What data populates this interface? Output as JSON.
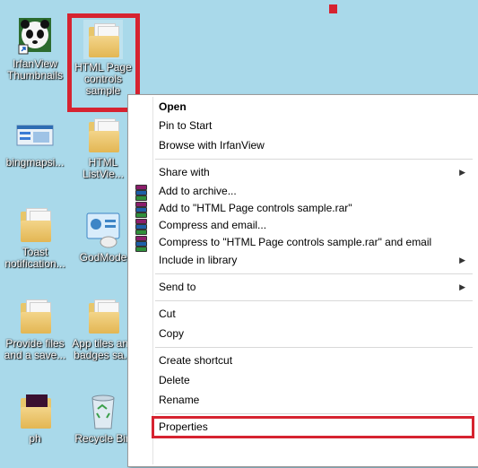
{
  "desktop": {
    "icons": [
      {
        "label": "IrfanView Thumbnails"
      },
      {
        "label": "HTML Page controls sample"
      },
      {
        "label": "bingmapsi..."
      },
      {
        "label": "HTML ListVie..."
      },
      {
        "label": "Toast notification..."
      },
      {
        "label": "GodMode"
      },
      {
        "label": "Provide files and a save..."
      },
      {
        "label": "App tiles and badges sa..."
      },
      {
        "label": "ph"
      },
      {
        "label": "Recycle Bin"
      }
    ]
  },
  "context_menu": {
    "items": [
      {
        "label": "Open"
      },
      {
        "label": "Pin to Start"
      },
      {
        "label": "Browse with IrfanView"
      },
      {
        "label": "Share with"
      },
      {
        "label": "Add to archive..."
      },
      {
        "label": "Add to \"HTML Page controls sample.rar\""
      },
      {
        "label": "Compress and email..."
      },
      {
        "label": "Compress to \"HTML Page controls sample.rar\" and email"
      },
      {
        "label": "Include in library"
      },
      {
        "label": "Send to"
      },
      {
        "label": "Cut"
      },
      {
        "label": "Copy"
      },
      {
        "label": "Create shortcut"
      },
      {
        "label": "Delete"
      },
      {
        "label": "Rename"
      },
      {
        "label": "Properties"
      }
    ]
  },
  "colors": {
    "desktop": "#a9d9ea",
    "highlight": "#d62330"
  },
  "icons": {
    "irfanview": "panda-icon",
    "folder": "folder-icon",
    "control_panel": "control-panel-icon",
    "recycle_bin": "recycle-bin-icon",
    "archive": "winrar-icon",
    "submenu": "chevron-right-icon"
  }
}
